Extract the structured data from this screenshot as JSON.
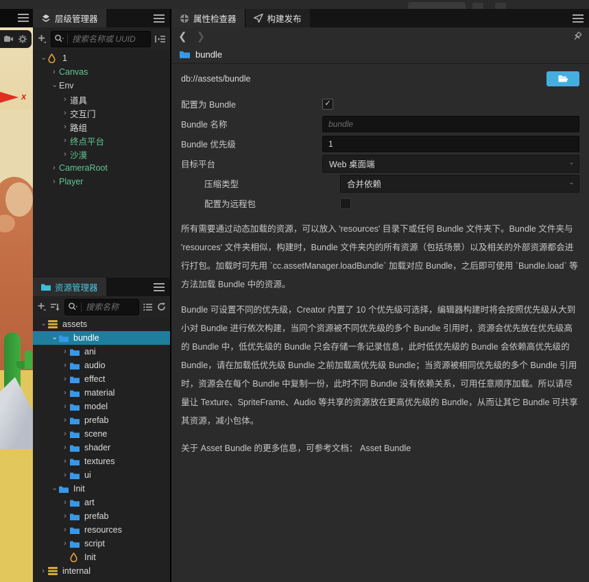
{
  "scene": {
    "gizmo_axis_label": "x"
  },
  "hierarchy": {
    "title": "层级管理器",
    "search_placeholder": "搜索名称或 UUID",
    "tree": [
      {
        "label": "1"
      },
      {
        "label": "Canvas"
      },
      {
        "label": "Env"
      },
      {
        "label": "道具"
      },
      {
        "label": "交互门"
      },
      {
        "label": "路组"
      },
      {
        "label": "终点平台"
      },
      {
        "label": "沙漠"
      },
      {
        "label": "CameraRoot"
      },
      {
        "label": "Player"
      }
    ]
  },
  "assets": {
    "title": "资源管理器",
    "search_placeholder": "搜索名称",
    "tree": [
      {
        "label": "assets"
      },
      {
        "label": "bundle"
      },
      {
        "label": "ani"
      },
      {
        "label": "audio"
      },
      {
        "label": "effect"
      },
      {
        "label": "material"
      },
      {
        "label": "model"
      },
      {
        "label": "prefab"
      },
      {
        "label": "scene"
      },
      {
        "label": "shader"
      },
      {
        "label": "textures"
      },
      {
        "label": "ui"
      },
      {
        "label": "Init"
      },
      {
        "label": "art"
      },
      {
        "label": "prefab"
      },
      {
        "label": "resources"
      },
      {
        "label": "script"
      },
      {
        "label": "Init"
      },
      {
        "label": "internal"
      }
    ]
  },
  "inspector": {
    "tab_inspector": "属性检查器",
    "tab_build": "构建发布",
    "selected_asset": "bundle",
    "asset_path": "db://assets/bundle",
    "form": {
      "is_bundle_label": "配置为 Bundle",
      "is_bundle_checked": true,
      "check_glyph": "✓",
      "name_label": "Bundle 名称",
      "name_placeholder": "bundle",
      "priority_label": "Bundle 优先级",
      "priority_value": "1",
      "platform_label": "目标平台",
      "platform_value": "Web 桌面端",
      "compression_label": "压缩类型",
      "compression_value": "合并依赖",
      "remote_label": "配置为远程包",
      "remote_checked": false
    },
    "paragraphs": {
      "p1": "所有需要通过动态加载的资源，可以放入 'resources' 目录下或任何 Bundle 文件夹下。Bundle 文件夹与 'resources' 文件夹相似，构建时，Bundle 文件夹内的所有资源（包括场景）以及相关的外部资源都会进行打包。加载时可先用 `cc.assetManager.loadBundle` 加载对应 Bundle，之后即可使用 `Bundle.load` 等方法加载 Bundle 中的资源。",
      "p2": "Bundle 可设置不同的优先级，Creator 内置了 10 个优先级可选择，编辑器构建时将会按照优先级从大到小对 Bundle 进行依次构建，当同个资源被不同优先级的多个 Bundle 引用时，资源会优先放在优先级高的 Bundle 中，低优先级的 Bundle 只会存储一条记录信息，此时低优先级的 Bundle 会依赖高优先级的 Bundle，请在加载低优先级 Bundle 之前加载高优先级 Bundle；当资源被相同优先级的多个 Bundle 引用时，资源会在每个 Bundle 中复制一份，此时不同 Bundle 没有依赖关系，可用任意顺序加载。所以请尽量让 Texture、SpriteFrame、Audio 等共享的资源放在更高优先级的 Bundle，从而让其它 Bundle 可共享其资源，减小包体。",
      "p3": "关于 Asset Bundle 的更多信息，可参考文档： Asset Bundle"
    }
  },
  "colors": {
    "selection_teal": "#1f7e9d",
    "folder_blue": "#3898e8",
    "assets_title_teal": "#4cc4dd",
    "tree_green": "#63c793",
    "scene_icon_orange": "#e6a23c",
    "db_icon_yellow": "#d4af37",
    "open_button_blue": "#46aede",
    "gizmo_red": "#df2f1f"
  }
}
